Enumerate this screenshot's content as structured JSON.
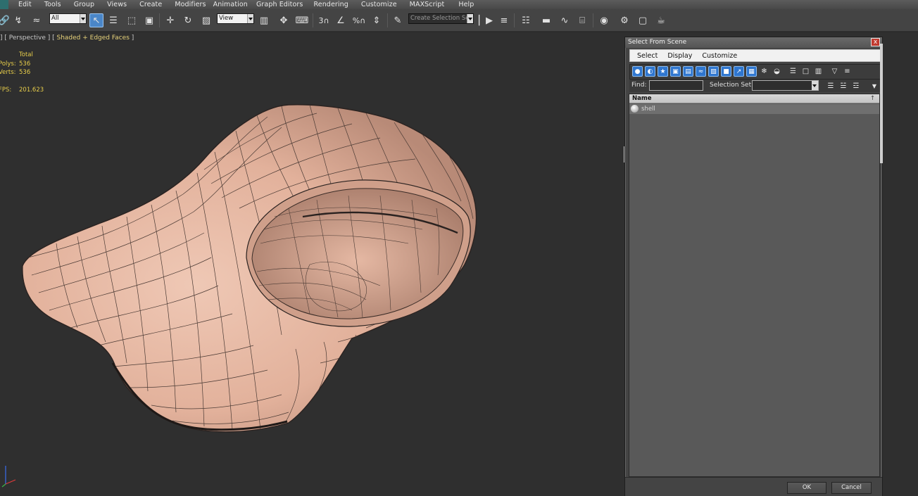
{
  "menubar": {
    "items": [
      "Edit",
      "Tools",
      "Group",
      "Views",
      "Create",
      "Modifiers",
      "Animation",
      "Graph Editors",
      "Rendering",
      "Customize",
      "MAXScript",
      "Help"
    ]
  },
  "toolbar": {
    "selection_filter": "All",
    "reference_coord": "View",
    "named_selection_set": "Create Selection Se",
    "icons": [
      "link-icon",
      "unlink-icon",
      "bind-space-warp-icon",
      "select-object-icon",
      "select-by-name-icon",
      "rectangular-selection-icon",
      "window-crossing-icon",
      "move-icon",
      "rotate-icon",
      "scale-icon",
      "pivot-icon",
      "keyboard-shortcut-icon",
      "snap-3d-icon",
      "angle-snap-icon",
      "percent-snap-icon",
      "spinner-snap-icon",
      "edit-named-selection-icon",
      "mirror-icon",
      "align-icon",
      "layer-explorer-icon",
      "toggle-ribbon-icon",
      "curve-editor-icon",
      "schematic-view-icon",
      "material-editor-icon",
      "render-setup-icon",
      "rendered-frame-icon",
      "render-icon"
    ]
  },
  "viewport": {
    "label_parts": [
      "] [ Perspective ] [ ",
      "Shaded + Edged Faces",
      " ]"
    ],
    "stats": {
      "header": "Total",
      "polys_key": "Polys:",
      "polys_value": "536",
      "verts_key": "Verts:",
      "verts_value": "536",
      "fps_key": "FPS:",
      "fps_value": "201.623"
    },
    "colors": {
      "mesh_fill": "#e6b8a4",
      "mesh_edge": "#3a2f2b",
      "background": "#2f2f2f",
      "stats_text": "#e7cd4a"
    }
  },
  "dialog": {
    "title": "Select From Scene",
    "close_label": "x",
    "menu": [
      "Select",
      "Display",
      "Customize"
    ],
    "find_label": "Find:",
    "find_value": "",
    "selection_set_label": "Selection Set:",
    "selection_set_value": "",
    "list": {
      "column_header": "Name",
      "sort_indicator": "↑",
      "rows": [
        {
          "name": "shell",
          "icon": "sphere-object-icon"
        }
      ]
    },
    "buttons": {
      "ok": "OK",
      "cancel": "Cancel"
    }
  }
}
